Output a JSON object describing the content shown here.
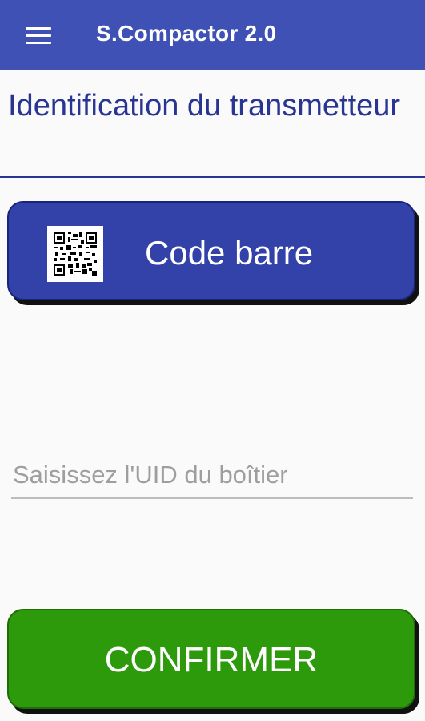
{
  "appbar": {
    "title": "S.Compactor 2.0",
    "menu_icon": "hamburger-menu-icon",
    "background_color": "#3f51b5"
  },
  "page": {
    "title": "Identification du transmetteur",
    "title_color": "#283593"
  },
  "barcode_button": {
    "label": "Code barre",
    "icon": "qr-code-icon",
    "color": "#3242a8"
  },
  "uid_input": {
    "placeholder": "Saisissez l'UID du boîtier",
    "value": ""
  },
  "confirm_button": {
    "label": "CONFIRMER",
    "color": "#2d9a0c"
  }
}
